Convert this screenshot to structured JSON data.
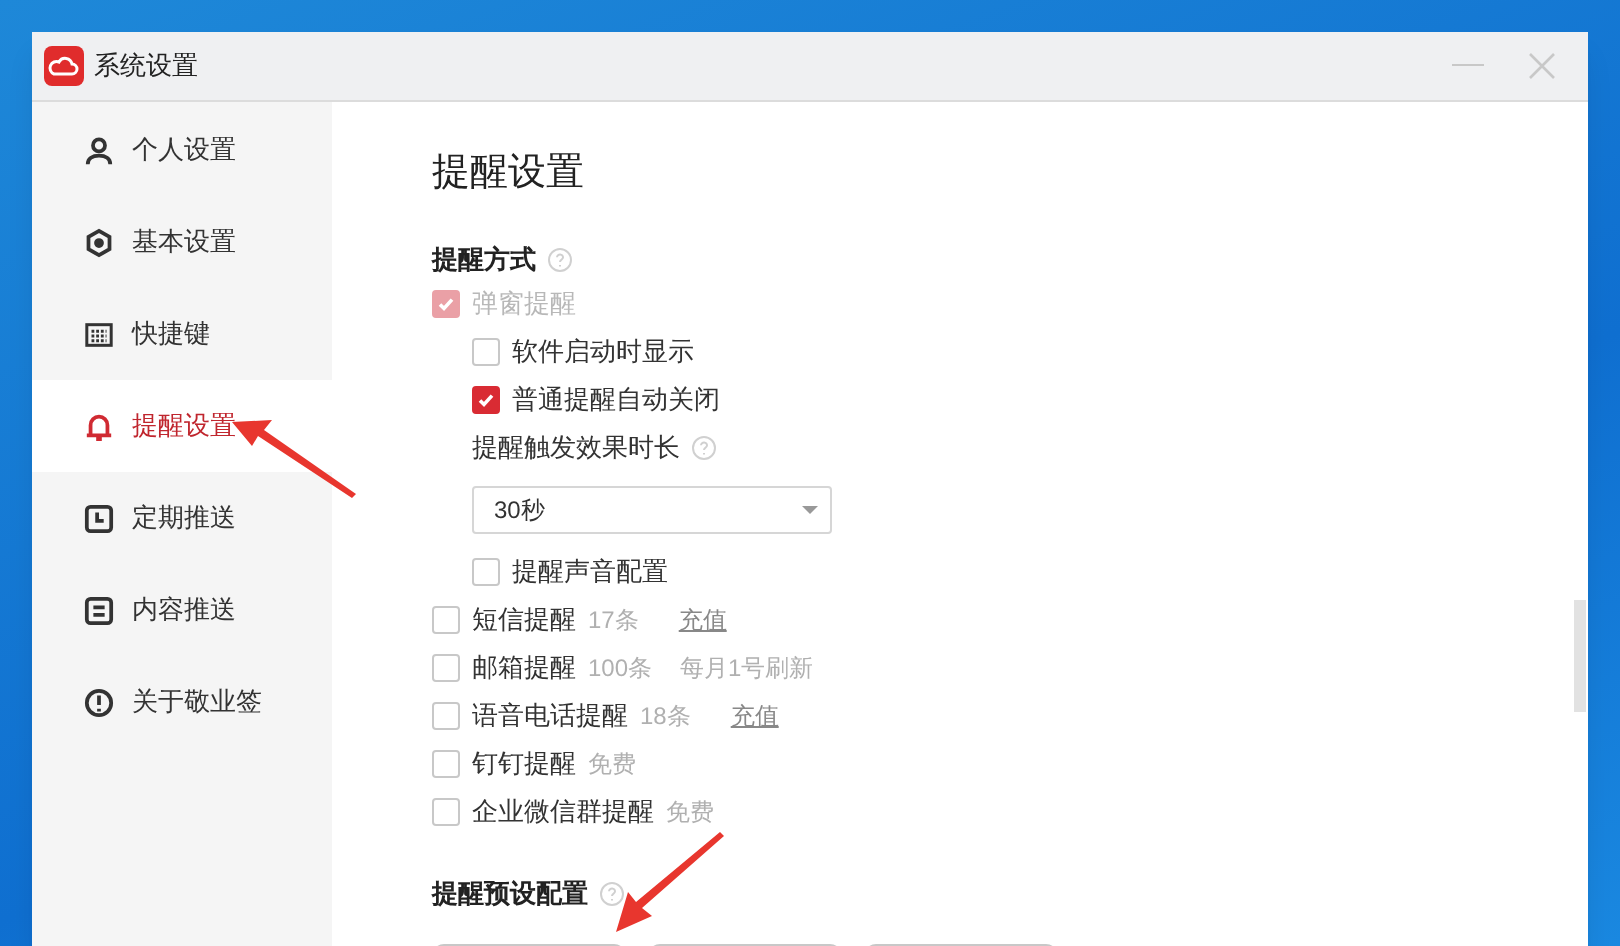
{
  "window": {
    "title": "系统设置"
  },
  "sidebar": {
    "items": [
      {
        "label": "个人设置",
        "selected": false
      },
      {
        "label": "基本设置",
        "selected": false
      },
      {
        "label": "快捷键",
        "selected": false
      },
      {
        "label": "提醒设置",
        "selected": true
      },
      {
        "label": "定期推送",
        "selected": false
      },
      {
        "label": "内容推送",
        "selected": false
      },
      {
        "label": "关于敬业签",
        "selected": false
      }
    ]
  },
  "content": {
    "title": "提醒设置",
    "methods_section": {
      "heading": "提醒方式",
      "help": true,
      "items": [
        {
          "label": "弹窗提醒",
          "checked": true,
          "disabled": true,
          "children": [
            {
              "kind": "checkbox",
              "label": "软件启动时显示",
              "checked": false
            },
            {
              "kind": "checkbox",
              "label": "普通提醒自动关闭",
              "checked": true
            },
            {
              "kind": "label",
              "label": "提醒触发效果时长",
              "help": true
            },
            {
              "kind": "select",
              "value": "30秒"
            },
            {
              "kind": "checkbox",
              "label": "提醒声音配置",
              "checked": false
            }
          ]
        },
        {
          "label": "短信提醒",
          "checked": false,
          "quota": "17条",
          "link": "充值"
        },
        {
          "label": "邮箱提醒",
          "checked": false,
          "quota": "100条",
          "note": "每月1号刷新"
        },
        {
          "label": "语音电话提醒",
          "checked": false,
          "quota": "18条",
          "link": "充值"
        },
        {
          "label": "钉钉提醒",
          "checked": false,
          "quota": "免费"
        },
        {
          "label": "企业微信群提醒",
          "checked": false,
          "quota": "免费"
        }
      ]
    },
    "presets_section": {
      "heading": "提醒预设配置",
      "help": true
    }
  }
}
